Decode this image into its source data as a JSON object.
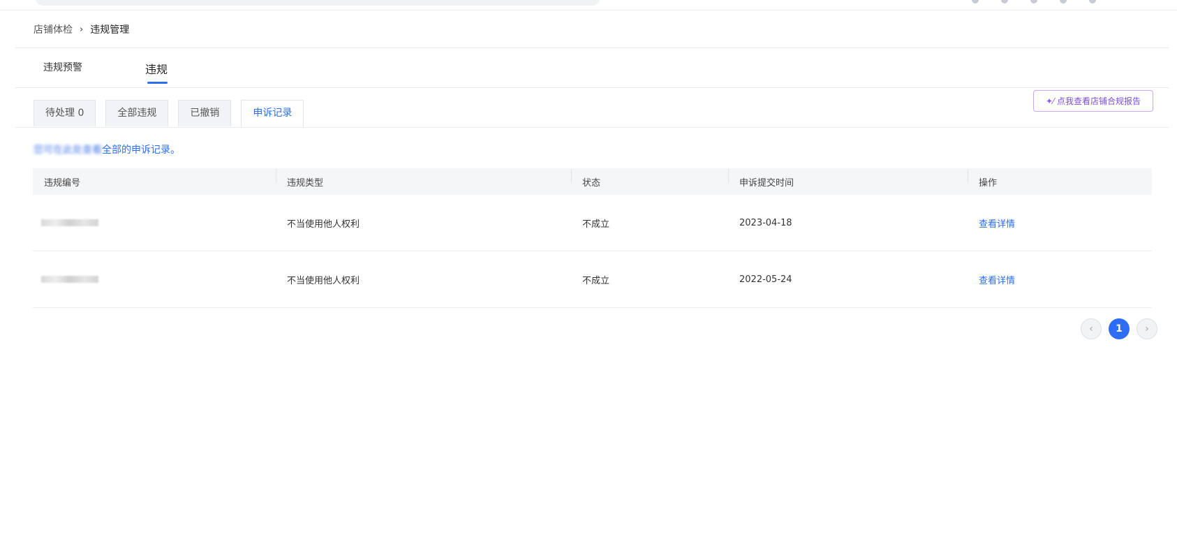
{
  "breadcrumb": {
    "parent": "店铺体检",
    "separator": "›",
    "current": "违规管理"
  },
  "main_tabs": [
    {
      "label": "违规预警"
    },
    {
      "label": "违规"
    }
  ],
  "sub_tabs": [
    {
      "label": "待处理 0"
    },
    {
      "label": "全部违规"
    },
    {
      "label": "已撤销"
    },
    {
      "label": "申诉记录"
    }
  ],
  "report_button": {
    "icon": "sparkle-icon",
    "label": "点我查看店铺合规报告"
  },
  "notice": {
    "blurred_prefix": "您可在此处查看",
    "text": "全部的申诉记录。"
  },
  "table": {
    "headers": [
      "违规编号",
      "违规类型",
      "状态",
      "申诉提交时间",
      "操作"
    ],
    "rows": [
      {
        "id": "",
        "type": "不当使用他人权利",
        "status": "不成立",
        "time": "2023-04-18",
        "action": "查看详情"
      },
      {
        "id": "",
        "type": "不当使用他人权利",
        "status": "不成立",
        "time": "2022-05-24",
        "action": "查看详情"
      }
    ]
  },
  "pagination": {
    "prev": "‹",
    "current": "1",
    "next": "›"
  },
  "colors": {
    "accent": "#2d6df6",
    "report_border": "#c9a6f0"
  }
}
